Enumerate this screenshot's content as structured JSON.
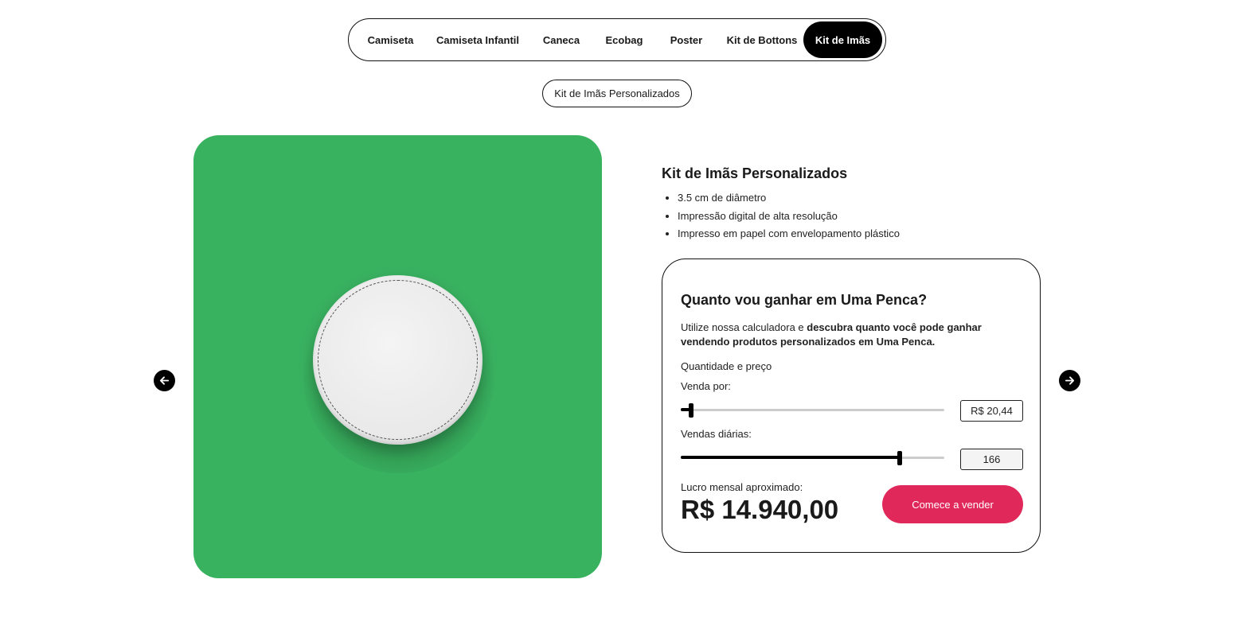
{
  "nav": {
    "tabs": [
      {
        "label": "Camiseta",
        "active": false
      },
      {
        "label": "Camiseta Infantil",
        "active": false
      },
      {
        "label": "Caneca",
        "active": false
      },
      {
        "label": "Ecobag",
        "active": false
      },
      {
        "label": "Poster",
        "active": false
      },
      {
        "label": "Kit de Bottons",
        "active": false
      },
      {
        "label": "Kit de Imãs",
        "active": true
      }
    ],
    "subtab": "Kit de Imãs Personalizados"
  },
  "colors": {
    "image_background": "#39b260",
    "cta_background": "#e0285a"
  },
  "product": {
    "title": "Kit de Imãs Personalizados",
    "features": [
      "3.5 cm de diâmetro",
      "Impressão digital de alta resolução",
      "Impresso em papel com envelopamento plástico"
    ]
  },
  "calculator": {
    "title": "Quanto vou ganhar em Uma Penca?",
    "desc_prefix": "Utilize nossa calculadora e ",
    "desc_bold": "descubra quanto você pode ganhar vendendo produtos personalizados em Uma Penca.",
    "section_label": "Quantidade e preço",
    "price_label": "Venda por:",
    "price_value": "R$ 20,44",
    "price_slider_fraction": 0.04,
    "sales_label": "Vendas diárias:",
    "sales_value": "166",
    "sales_slider_fraction": 0.83,
    "profit_label": "Lucro mensal aproximado:",
    "profit_value": "R$ 14.940,00",
    "cta_label": "Comece a vender"
  },
  "carousel": {
    "prev_icon": "arrow-left-icon",
    "next_icon": "arrow-right-icon"
  }
}
